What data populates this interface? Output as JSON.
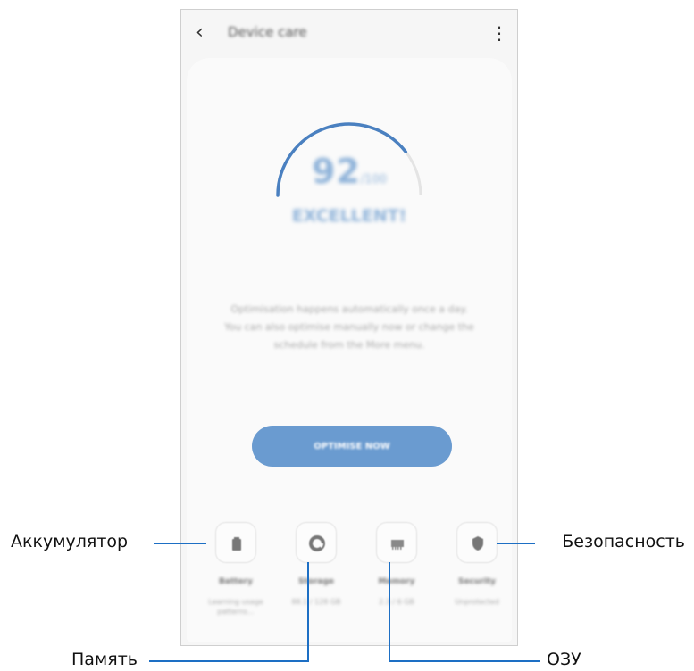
{
  "app": {
    "title": "Device care",
    "back_icon": "back-arrow-icon",
    "more_icon": "more-vert-icon"
  },
  "score": {
    "value": "92",
    "max": "/100",
    "rating": "EXCELLENT!"
  },
  "description": [
    "Optimisation happens automatically once a day.",
    "You can also optimise manually now or change the",
    "schedule from the More menu."
  ],
  "optimize_button": "OPTIMISE NOW",
  "tiles": [
    {
      "name": "Battery",
      "value": "Learning usage patterns...",
      "icon": "battery-icon"
    },
    {
      "name": "Storage",
      "value": "88.1 / 128 GB",
      "icon": "storage-icon"
    },
    {
      "name": "Memory",
      "value": "2.3 / 6 GB",
      "icon": "memory-icon"
    },
    {
      "name": "Security",
      "value": "Unprotected",
      "icon": "shield-icon"
    }
  ],
  "callouts": {
    "battery": "Аккумулятор",
    "storage": "Память",
    "memory": "ОЗУ",
    "security": "Безопасность"
  },
  "colors": {
    "accent": "#6a9bd0",
    "gauge": "#4a80c0",
    "callout_line": "#1d6fc4"
  }
}
